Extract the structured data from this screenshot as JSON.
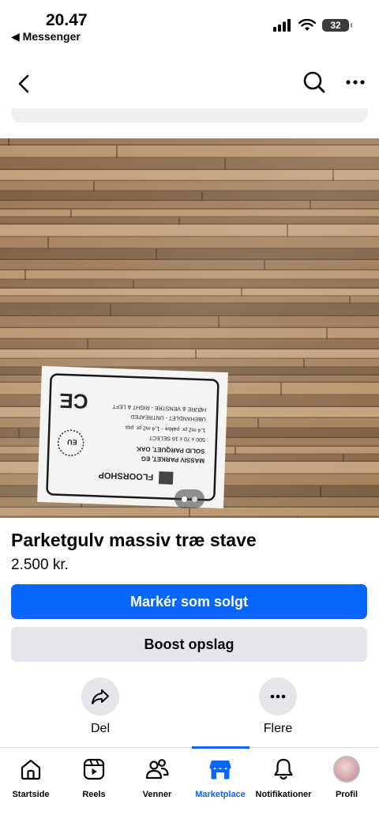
{
  "status_bar": {
    "time": "20.47",
    "back_app": "◀ Messenger",
    "battery": "32"
  },
  "listing": {
    "title": "Parketgulv massiv træ stave",
    "price": "2.500 kr.",
    "photo_count": 2,
    "current_photo": 1
  },
  "label_sticker": {
    "brand": "FLOORSHOP",
    "lines": [
      "MASSIV PARKET, EG",
      "SOLID PARQUET, OAK",
      "500 x 70 x 16 SELECT",
      "1,4 m2 pr. pakke - 1,4 m2 pr. pcs",
      "UBEHANDLET - UNTREATED",
      "HØJRE & VENSTRE - RIGHT & LEFT"
    ],
    "marks": [
      "CE",
      "EU"
    ]
  },
  "buttons": {
    "mark_sold": "Markér som solgt",
    "boost": "Boost opslag"
  },
  "actions": {
    "share": "Del",
    "more": "Flere"
  },
  "tabs": [
    {
      "label": "Startside",
      "icon": "home-icon"
    },
    {
      "label": "Reels",
      "icon": "reels-icon"
    },
    {
      "label": "Venner",
      "icon": "friends-icon"
    },
    {
      "label": "Marketplace",
      "icon": "marketplace-icon",
      "active": true
    },
    {
      "label": "Notifikationer",
      "icon": "bell-icon"
    },
    {
      "label": "Profil",
      "icon": "avatar"
    }
  ],
  "colors": {
    "primary": "#0866ff",
    "secondary_button": "#e4e6eb",
    "text": "#050505"
  }
}
